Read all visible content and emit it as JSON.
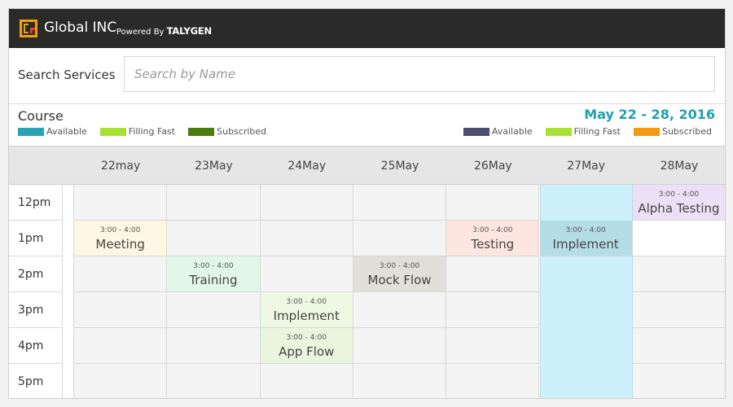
{
  "header": {
    "brand": "Global INC",
    "powered_by": "Powered By",
    "powered_brand": "TALYGEN"
  },
  "search": {
    "label": "Search Services",
    "placeholder": "Search by Name",
    "value": ""
  },
  "course": {
    "title": "Course",
    "date_range": "May 22 - 28, 2016"
  },
  "legend_left": [
    {
      "label": "Available",
      "color": "#27a3b4"
    },
    {
      "label": "Filling Fast",
      "color": "#a9e034"
    },
    {
      "label": "Subscribed",
      "color": "#4c7c10"
    }
  ],
  "legend_right": [
    {
      "label": "Available",
      "color": "#4a4f72"
    },
    {
      "label": "Filling Fast",
      "color": "#a9e034"
    },
    {
      "label": "Subscribed",
      "color": "#f39a10"
    }
  ],
  "days": [
    "22may",
    "23May",
    "24May",
    "25May",
    "26May",
    "27May",
    "28May"
  ],
  "times": [
    "12pm",
    "1pm",
    "2pm",
    "3pm",
    "4pm",
    "5pm"
  ],
  "events": [
    {
      "day": 6,
      "row": 0,
      "time": "3:00 - 4:00",
      "name": "Alpha Testing",
      "color": "#ece0f6"
    },
    {
      "day": 0,
      "row": 1,
      "time": "3:00 - 4:00",
      "name": "Meeting",
      "color": "#fdf6e2"
    },
    {
      "day": 4,
      "row": 1,
      "time": "3:00 - 4:00",
      "name": "Testing",
      "color": "#fde6df"
    },
    {
      "day": 5,
      "row": 1,
      "time": "3:00 - 4:00",
      "name": "Implement",
      "color": "#b5dde6"
    },
    {
      "day": 1,
      "row": 2,
      "time": "3:00 - 4:00",
      "name": "Training",
      "color": "#e2f7ea"
    },
    {
      "day": 3,
      "row": 2,
      "time": "3:00 - 4:00",
      "name": "Mock Flow",
      "color": "#e1dfda"
    },
    {
      "day": 2,
      "row": 3,
      "time": "3:00 - 4:00",
      "name": "Implement",
      "color": "#eef9e4"
    },
    {
      "day": 2,
      "row": 4,
      "time": "3:00 - 4:00",
      "name": "App Flow",
      "color": "#e9f6dd"
    }
  ],
  "colors": {
    "header_bg": "#2a2a2a",
    "accent": "#1ea1b1",
    "available_column": "#cdf1fb"
  }
}
